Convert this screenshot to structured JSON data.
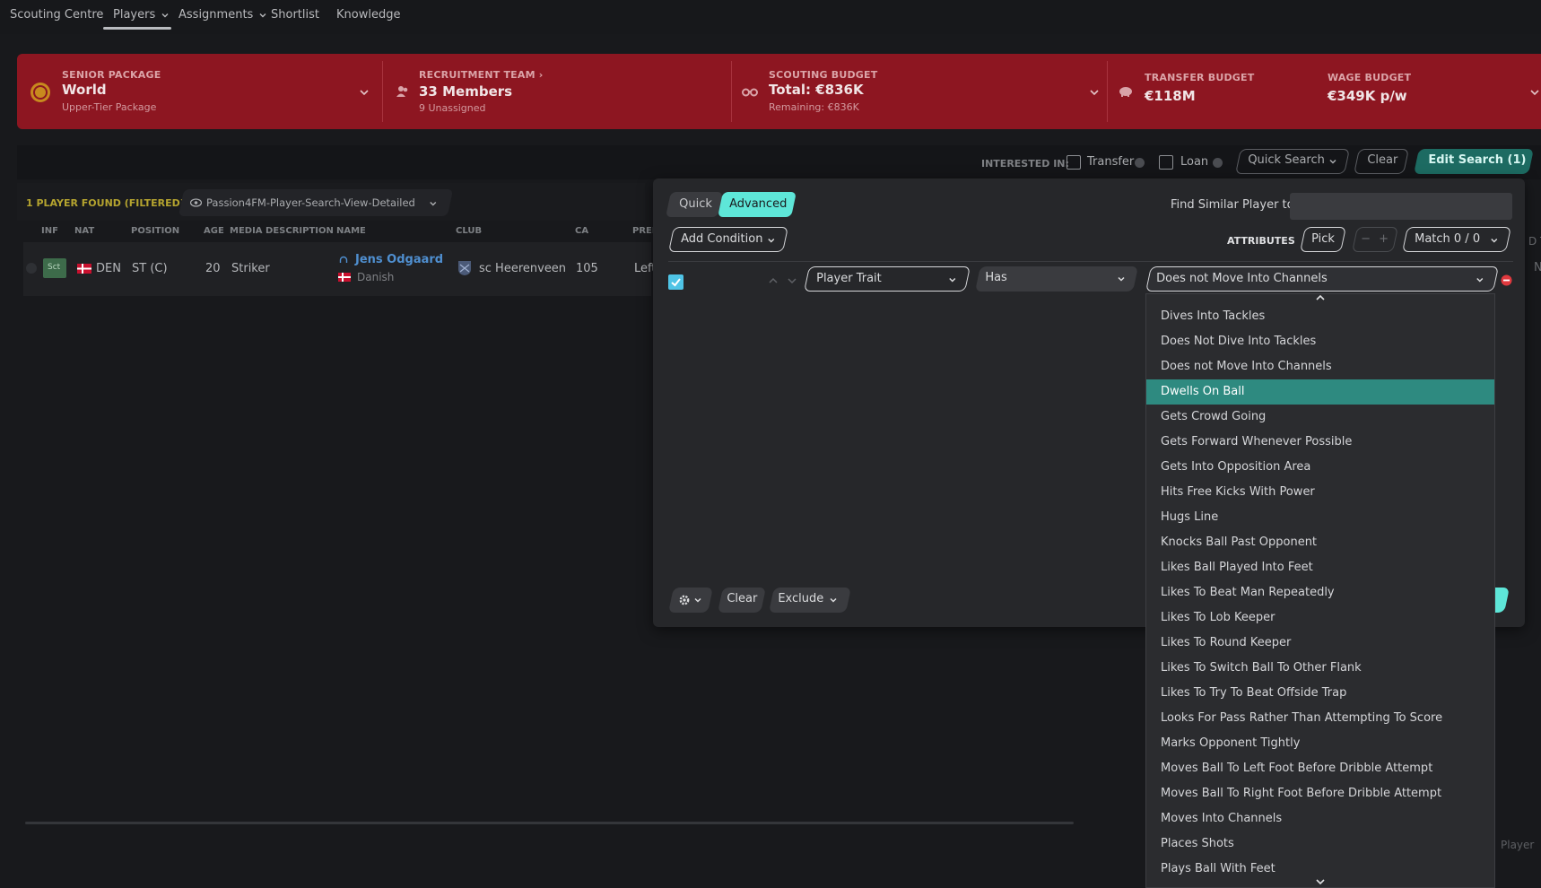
{
  "nav": {
    "items": [
      "Scouting Centre",
      "Players",
      "Assignments",
      "Shortlist",
      "Knowledge"
    ]
  },
  "banner": {
    "senior": {
      "caption": "SENIOR PACKAGE",
      "main": "World",
      "sub": "Upper-Tier Package"
    },
    "recruitment": {
      "caption": "RECRUITMENT TEAM",
      "main": "33 Members",
      "sub": "9 Unassigned"
    },
    "scouting": {
      "caption": "SCOUTING BUDGET",
      "main": "Total: €836K",
      "sub": "Remaining: €836K"
    },
    "transfer": {
      "caption": "TRANSFER BUDGET",
      "main": "€118M"
    },
    "wage": {
      "caption": "WAGE BUDGET",
      "main": "€349K p/w"
    }
  },
  "searchbar": {
    "interested_label": "INTERESTED IN:",
    "transfer_label": "Transfer",
    "loan_label": "Loan",
    "quick_search": "Quick Search",
    "clear": "Clear",
    "edit_search": "Edit Search (1)"
  },
  "results": {
    "found": "1 PLAYER FOUND (FILTERED)",
    "view": "Passion4FM-Player-Search-View-Detailed",
    "columns": [
      "INF",
      "NAT",
      "POSITION",
      "AGE",
      "MEDIA DESCRIPTION",
      "NAME",
      "CLUB",
      "CA",
      "PREF"
    ],
    "row": {
      "inf": "Sct",
      "nat": "DEN",
      "position": "ST (C)",
      "age": "20",
      "media": "Striker",
      "name": "Jens Odgaard",
      "nationality": "Danish",
      "club": "sc Heerenveen",
      "ca": "105",
      "pref": "Left"
    },
    "edge_letter_n": "N",
    "edge_letter_d": "D T",
    "player_button": "Player"
  },
  "panel": {
    "tabs": {
      "quick": "Quick",
      "advanced": "Advanced"
    },
    "find_similar": "Find Similar Player to",
    "add_condition": "Add Condition",
    "attributes": "ATTRIBUTES",
    "pick": "Pick",
    "minus": "−",
    "plus": "+",
    "match": "Match 0 / 0",
    "condition": {
      "field": "Player Trait",
      "operator": "Has",
      "value": "Does not Move Into Channels"
    },
    "footer": {
      "clear": "Clear",
      "exclude": "Exclude"
    }
  },
  "dropdown": {
    "selected_index": 3,
    "options": [
      "Dives Into Tackles",
      "Does Not Dive Into Tackles",
      "Does not Move Into Channels",
      "Dwells On Ball",
      "Gets Crowd Going",
      "Gets Forward Whenever Possible",
      "Gets Into Opposition Area",
      "Hits Free Kicks With Power",
      "Hugs Line",
      "Knocks Ball Past Opponent",
      "Likes Ball Played Into Feet",
      "Likes To Beat Man Repeatedly",
      "Likes To Lob Keeper",
      "Likes To Round Keeper",
      "Likes To Switch Ball To Other Flank",
      "Likes To Try To Beat Offside Trap",
      "Looks For Pass Rather Than Attempting To Score",
      "Marks Opponent Tightly",
      "Moves Ball To Left Foot Before Dribble Attempt",
      "Moves Ball To Right Foot Before Dribble Attempt",
      "Moves Into Channels",
      "Places Shots",
      "Plays Ball With Feet"
    ]
  },
  "colors": {
    "banner": "#8d1621",
    "accent_teal": "#5ee6d8",
    "selected_row": "#2e8a80",
    "name_link": "#4f8fd0",
    "found_text": "#b5a42f"
  }
}
